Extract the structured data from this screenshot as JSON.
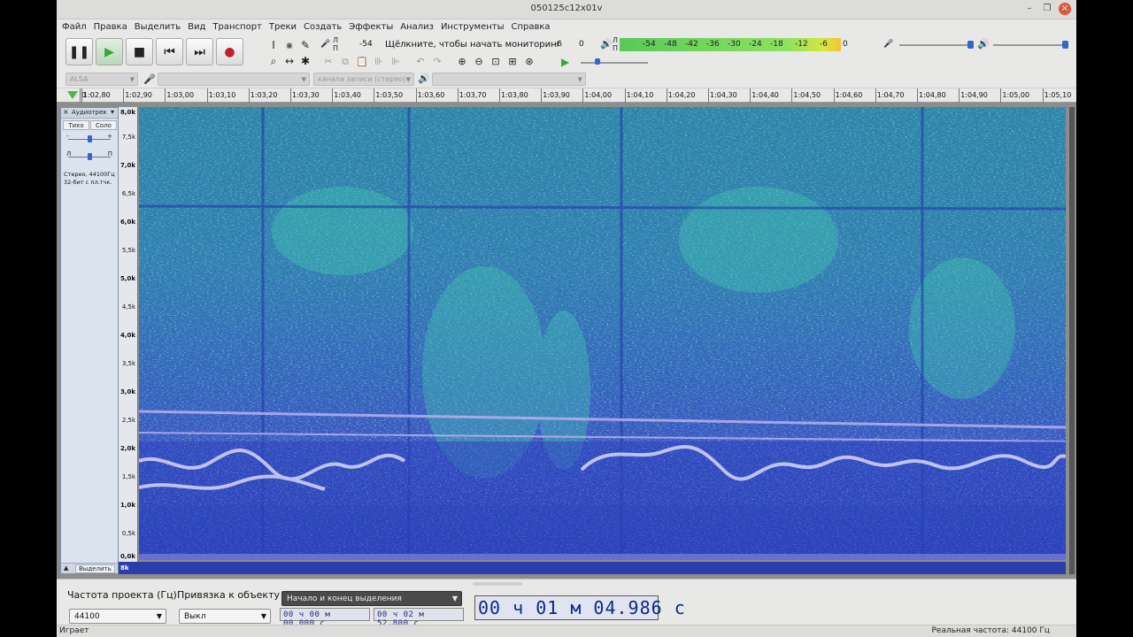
{
  "window": {
    "title": "050125c12x01v"
  },
  "menu": [
    "Файл",
    "Правка",
    "Выделить",
    "Вид",
    "Транспорт",
    "Треки",
    "Создать",
    "Эффекты",
    "Анализ",
    "Инструменты",
    "Справка"
  ],
  "recording_meter": {
    "monitor_text": "Щёлкните, чтобы начать мониторинг",
    "left_value": "-54",
    "mid_value": "-6",
    "right_value": "0",
    "channel_l": "Л",
    "channel_r": "П"
  },
  "playback_meter": {
    "labels": [
      "-54",
      "-48",
      "-42",
      "-36",
      "-30",
      "-24",
      "-18",
      "-12",
      "-6",
      "0"
    ],
    "channel_l": "Л",
    "channel_r": "П",
    "level_fraction": 0.92
  },
  "device": {
    "host": "ALSA",
    "channels": "канала записи (стерео)"
  },
  "ruler": {
    "labels": [
      "0",
      "1:02,80",
      "1:02,90",
      "1:03,00",
      "1:03,10",
      "1:03,20",
      "1:03,30",
      "1:03,40",
      "1:03,50",
      "1:03,60",
      "1:03,70",
      "1:03,80",
      "1:03,90",
      "1:04,00",
      "1:04,10",
      "1:04,20",
      "1:04,30",
      "1:04,40",
      "1:04,50",
      "1:04,60",
      "1:04,70",
      "1:04,80",
      "1:04,90",
      "1:05,00",
      "1:05,10"
    ]
  },
  "track": {
    "name": "Аудиотрек",
    "mute_label": "Тихо",
    "solo_label": "Соло",
    "gain_minus": "-",
    "gain_plus": "+",
    "pan_left": "Л",
    "pan_right": "П",
    "info_line1": "Стерео, 44100Гц",
    "info_line2": "32-бит с пл.тчк.",
    "select_label": "Выделить",
    "bottom_label": "8k"
  },
  "frequency_scale": {
    "major": [
      "8,0k",
      "7,0k",
      "6,0k",
      "5,0k",
      "4,0k",
      "3,0k",
      "2,0k",
      "1,0k",
      "0,0k"
    ],
    "minor": [
      "7,5k",
      "6,5k",
      "5,5k",
      "4,5k",
      "3,5k",
      "2,5k",
      "1,5k",
      "0,5k"
    ]
  },
  "selection_bar": {
    "rate_label": "Частота проекта (Гц)",
    "rate_value": "44100",
    "snap_label": "Привязка к объекту",
    "snap_value": "Выкл",
    "selection_mode": "Начало и конец выделения",
    "start_time": "00 ч 00 м 00.000 с",
    "end_time": "00 ч 02 м 52.800 с",
    "position": "00 ч 01 м 04.986 с"
  },
  "status": {
    "left": "Играет",
    "right": "Реальная частота: 44100 Гц"
  },
  "colors": {
    "spectrogram_low": "#2b3fb8",
    "spectrogram_mid": "#2fa8a0",
    "spectrogram_high": "#e8e8f4",
    "play_green": "#35a83a",
    "record_red": "#c0202a"
  }
}
